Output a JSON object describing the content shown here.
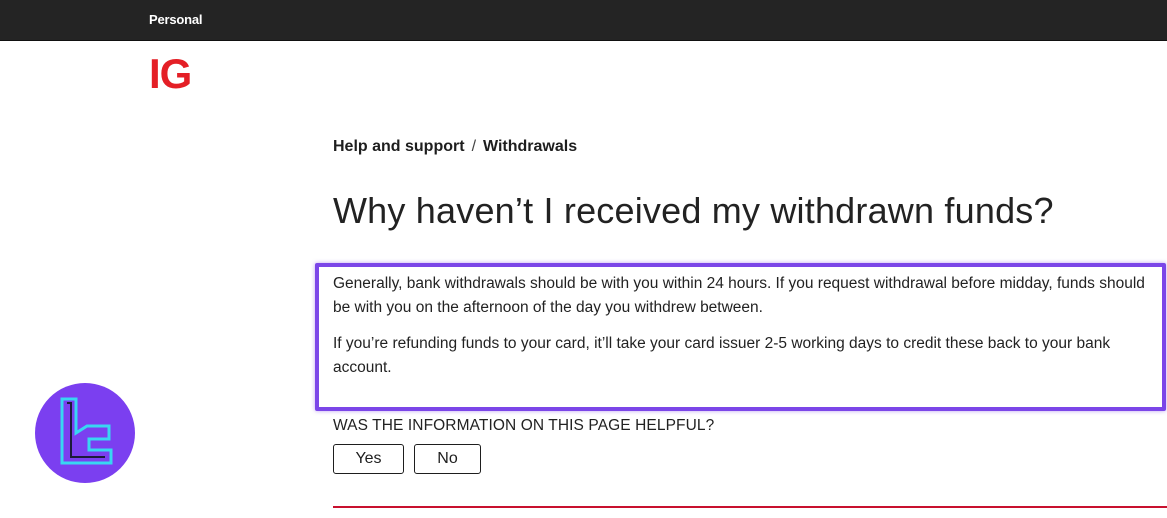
{
  "topbar": {
    "personal_label": "Personal"
  },
  "brand": {
    "logo_text": "IG",
    "logo_color": "#e41f26"
  },
  "breadcrumb": {
    "items": [
      "Help and support",
      "Withdrawals"
    ],
    "separator": "/"
  },
  "article": {
    "title": "Why haven’t I received my withdrawn funds?",
    "paragraphs": [
      "Generally, bank withdrawals should be with you within 24 hours. If you request withdrawal before midday, funds should be with you on the afternoon of the day you withdrew between.",
      "If you’re refunding funds to your card, it’ll take your card issuer 2-5 working days to credit these back to your bank account."
    ]
  },
  "feedback": {
    "question": "WAS THE INFORMATION ON THIS PAGE HELPFUL?",
    "yes_label": "Yes",
    "no_label": "No"
  },
  "colors": {
    "topbar": "#242424",
    "highlight": "#7b46e8",
    "accent_rule": "#c8102e"
  }
}
